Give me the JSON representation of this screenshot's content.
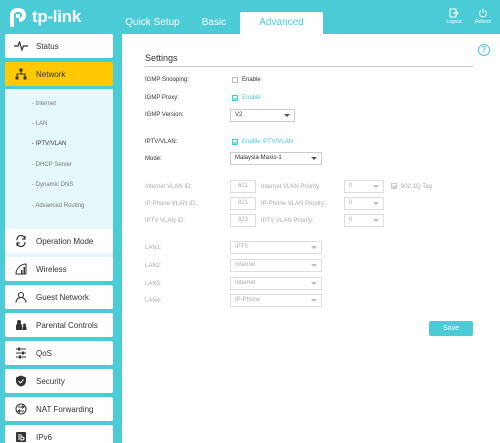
{
  "brand": {
    "name": "tp-link"
  },
  "header": {
    "tabs": [
      {
        "label": "Quick Setup"
      },
      {
        "label": "Basic"
      },
      {
        "label": "Advanced"
      }
    ],
    "logout_label": "Logout",
    "reboot_label": "Reboot"
  },
  "sidebar": {
    "items": [
      {
        "label": "Status",
        "icon": "pulse-icon"
      },
      {
        "label": "Network",
        "icon": "network-icon"
      },
      {
        "label": "Operation Mode",
        "icon": "operation-mode-icon"
      },
      {
        "label": "Wireless",
        "icon": "wifi-icon"
      },
      {
        "label": "Guest Network",
        "icon": "guest-icon"
      },
      {
        "label": "Parental Controls",
        "icon": "parental-icon"
      },
      {
        "label": "QoS",
        "icon": "qos-icon"
      },
      {
        "label": "Security",
        "icon": "shield-icon"
      },
      {
        "label": "NAT Forwarding",
        "icon": "nat-icon"
      },
      {
        "label": "IPv6",
        "icon": "ipv6-icon"
      }
    ],
    "network_submenu": [
      {
        "label": "- Internet"
      },
      {
        "label": "- LAN"
      },
      {
        "label": "- IPTV/VLAN"
      },
      {
        "label": "- DHCP Server"
      },
      {
        "label": "- Dynamic DNS"
      },
      {
        "label": "- Advanced Routing"
      }
    ]
  },
  "settings": {
    "title": "Settings",
    "igmp_snooping": {
      "label": "IGMP Snooping:",
      "option": "Enable"
    },
    "igmp_proxy": {
      "label": "IGMP Proxy:",
      "option": "Enable"
    },
    "igmp_version": {
      "label": "IGMP Version:",
      "value": "V2"
    },
    "iptv_vlan": {
      "label": "IPTV/VLAN:",
      "option": "Enable IPTV/VLAN"
    },
    "mode": {
      "label": "Mode:",
      "value": "Malaysia-Maxis-1"
    },
    "internet_vlan": {
      "label": "Internet VLAN ID:",
      "value": "621",
      "priority_label": "Internet VLAN Priority:",
      "priority": "0",
      "tag_label": "802.1Q Tag"
    },
    "ip_phone_vlan": {
      "label": "IP-Phone VLAN ID:",
      "value": "821",
      "priority_label": "IP-Phone VLAN Priority:",
      "priority": "0"
    },
    "iptv_vlan_id": {
      "label": "IPTV VLAN ID:",
      "value": "823",
      "priority_label": "IPTV VLAN Priority:",
      "priority": "0"
    },
    "lans": [
      {
        "label": "LAN1:",
        "value": "IPTV"
      },
      {
        "label": "LAN2:",
        "value": "Internet"
      },
      {
        "label": "LAN3:",
        "value": "Internet"
      },
      {
        "label": "LAN4:",
        "value": "IP-Phone"
      }
    ],
    "save_label": "Save"
  },
  "colors": {
    "accent": "#4acbd6",
    "active_menu": "#ffc800",
    "submenu_bg": "#e6f7f9"
  }
}
